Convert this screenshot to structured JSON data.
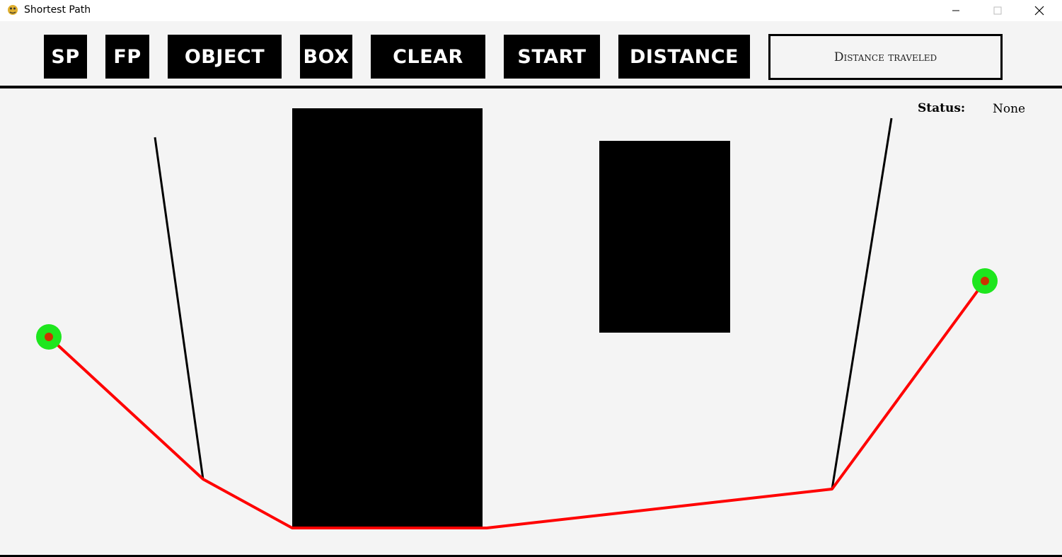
{
  "window": {
    "title": "Shortest Path",
    "app_icon": "pygame-snake-icon",
    "controls": {
      "minimize_icon": "minimize-icon",
      "maximize_icon": "maximize-icon",
      "close_icon": "close-icon"
    }
  },
  "toolbar": {
    "sp_label": "SP",
    "fp_label": "FP",
    "object_label": "OBJECT",
    "box_label": "BOX",
    "clear_label": "CLEAR",
    "start_label": "START",
    "distance_label": "DISTANCE",
    "distance_display": "Distance traveled"
  },
  "status": {
    "label": "Status:",
    "value": "None"
  },
  "colors": {
    "background": "#f4f4f4",
    "button_bg": "#000000",
    "button_text": "#ffffff",
    "path": "#ff0000",
    "endpoint_outer": "#1ee61e",
    "endpoint_inner": "#cc3300",
    "obstacle": "#000000"
  }
}
